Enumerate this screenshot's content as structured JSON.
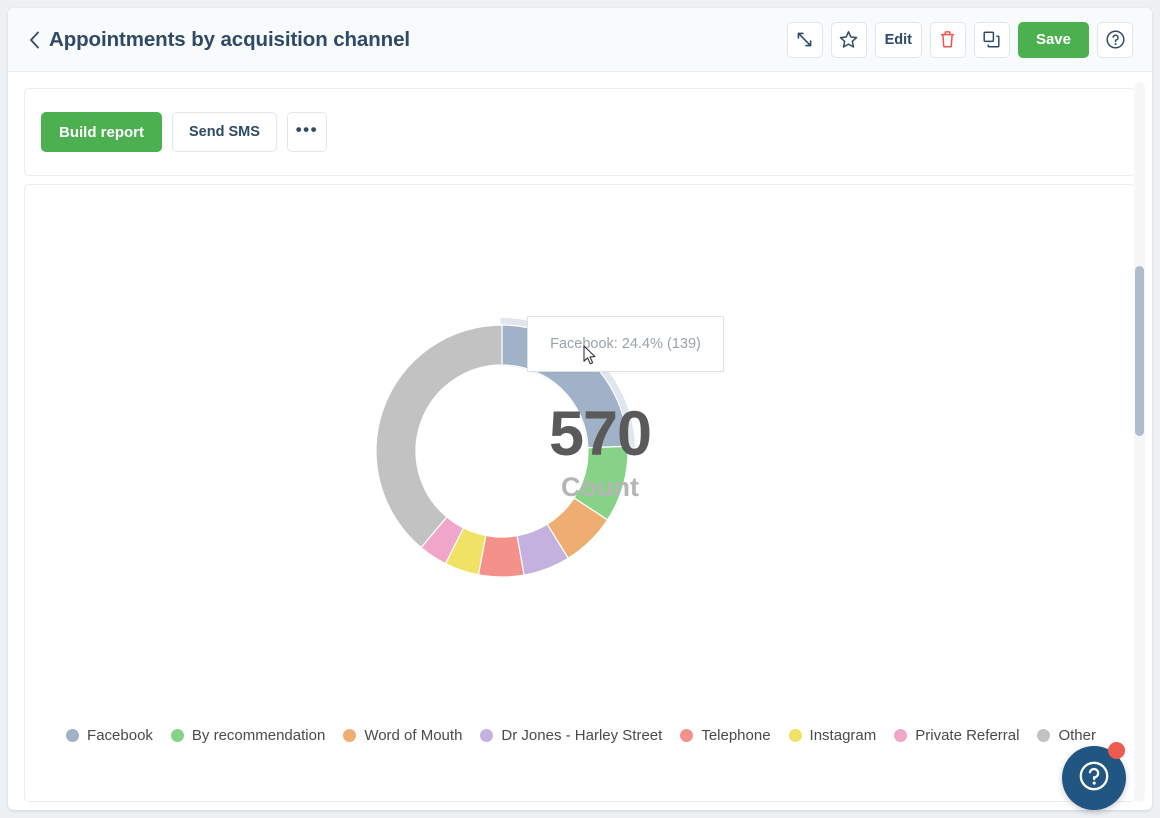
{
  "header": {
    "title": "Appointments by acquisition channel",
    "back_icon": "chevron-left-icon",
    "actions": [
      {
        "name": "expand-button",
        "icon": "expand-arrows-icon",
        "label": ""
      },
      {
        "name": "favourite-button",
        "icon": "star-icon",
        "label": ""
      },
      {
        "name": "edit-button",
        "icon": "",
        "label": "Edit"
      },
      {
        "name": "delete-button",
        "icon": "trash-icon",
        "label": ""
      },
      {
        "name": "duplicate-button",
        "icon": "copy-icon",
        "label": ""
      },
      {
        "name": "save-button",
        "icon": "",
        "label": "Save"
      },
      {
        "name": "help-button",
        "icon": "question-circle-icon",
        "label": ""
      }
    ]
  },
  "toolbar": {
    "build_report_label": "Build report",
    "send_sms_label": "Send SMS",
    "more_label": "•••"
  },
  "chart_card": {
    "center_value": "570",
    "center_caption": "Count",
    "tooltip": "Facebook: 24.4% (139)"
  },
  "colors": {
    "facebook": "#9fb2c8",
    "by_recommendation": "#86d387",
    "word_of_mouth": "#eeae72",
    "dr_jones": "#c4b1e0",
    "telephone": "#f3918a",
    "instagram": "#efe265",
    "private_referral": "#f0a6c8",
    "other": "#c2c2c2",
    "save_green": "#4caf50",
    "delete_red": "#ef5350",
    "title_navy": "#2e4a68",
    "chat_navy": "#215582",
    "chat_badge_red": "#ed5a4f"
  },
  "chat": {
    "icon": "question-circle-icon",
    "badge": ""
  },
  "chart_data": {
    "type": "pie",
    "variant": "donut",
    "title": "Appointments by acquisition channel",
    "center_value": 570,
    "center_label": "Count",
    "total": 570,
    "unit": "Count",
    "legend_position": "bottom",
    "highlighted_slice": "Facebook",
    "tooltip_text": "Facebook: 24.4% (139)",
    "categories": [
      "Facebook",
      "By recommendation",
      "Word of Mouth",
      "Dr Jones - Harley Street",
      "Telephone",
      "Instagram",
      "Private Referral",
      "Other"
    ],
    "values": [
      139,
      56,
      40,
      34,
      33,
      25,
      21,
      222
    ],
    "percents": [
      24.4,
      9.8,
      7.0,
      6.0,
      5.8,
      4.4,
      3.7,
      38.9
    ],
    "colors": [
      "#9fb2c8",
      "#86d387",
      "#eeae72",
      "#c4b1e0",
      "#f3918a",
      "#efe265",
      "#f0a6c8",
      "#c2c2c2"
    ],
    "series": [
      {
        "name": "Count",
        "points": [
          {
            "label": "Facebook",
            "value": 139,
            "percent": 24.4,
            "color": "#9fb2c8"
          },
          {
            "label": "By recommendation",
            "value": 56,
            "percent": 9.8,
            "color": "#86d387"
          },
          {
            "label": "Word of Mouth",
            "value": 40,
            "percent": 7.0,
            "color": "#eeae72"
          },
          {
            "label": "Dr Jones - Harley Street",
            "value": 34,
            "percent": 6.0,
            "color": "#c4b1e0"
          },
          {
            "label": "Telephone",
            "value": 33,
            "percent": 5.8,
            "color": "#f3918a"
          },
          {
            "label": "Instagram",
            "value": 25,
            "percent": 4.4,
            "color": "#efe265"
          },
          {
            "label": "Private Referral",
            "value": 21,
            "percent": 3.7,
            "color": "#f0a6c8"
          },
          {
            "label": "Other",
            "value": 222,
            "percent": 38.9,
            "color": "#c2c2c2"
          }
        ]
      }
    ]
  }
}
